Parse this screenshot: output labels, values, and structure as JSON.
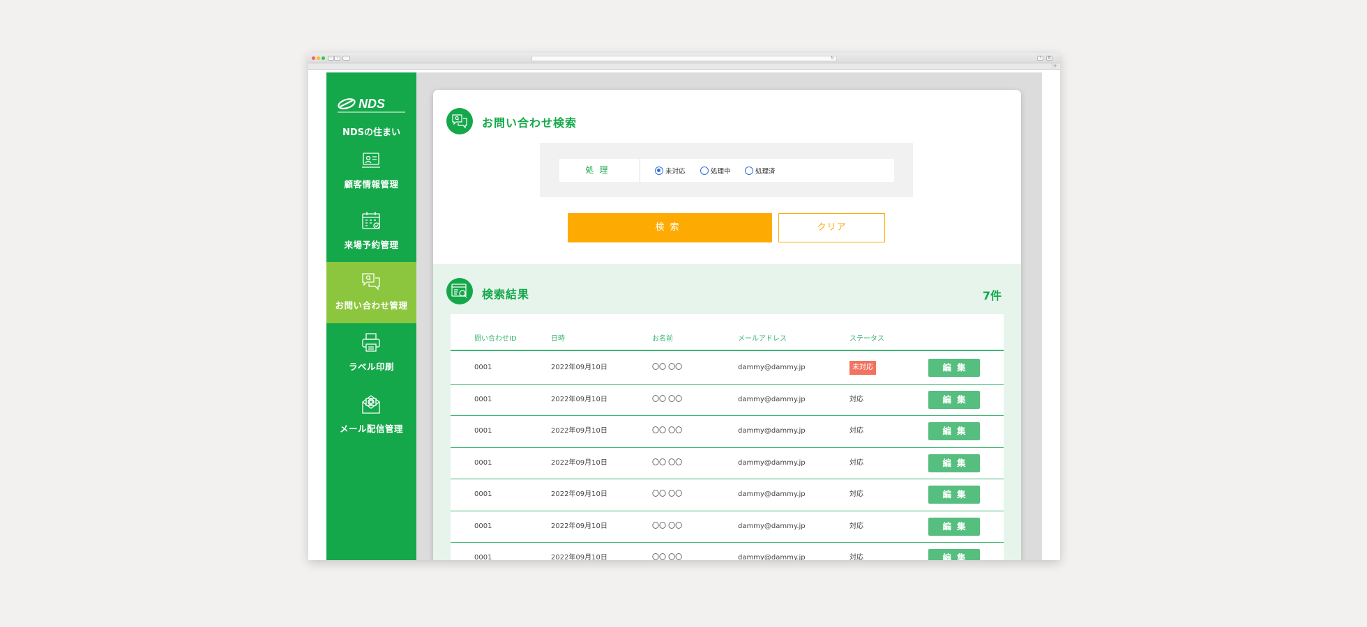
{
  "sidebar": {
    "brand": "NDSの住まい",
    "logo_text": "NDS",
    "items": [
      {
        "label": "顧客情報管理",
        "icon": "customer-info-icon"
      },
      {
        "label": "来場予約管理",
        "icon": "calendar-icon"
      },
      {
        "label": "お問い合わせ管理",
        "icon": "inquiry-icon",
        "active": true
      },
      {
        "label": "ラベル印刷",
        "icon": "printer-icon"
      },
      {
        "label": "メール配信管理",
        "icon": "mail-icon"
      }
    ]
  },
  "search": {
    "title": "お問い合わせ検索",
    "filter_label": "処理",
    "options": [
      {
        "label": "未対応",
        "checked": true
      },
      {
        "label": "処理中",
        "checked": false
      },
      {
        "label": "処理済",
        "checked": false
      }
    ],
    "search_button": "検索",
    "clear_button": "クリア"
  },
  "results": {
    "title": "検索結果",
    "count": "7件",
    "columns": [
      "問い合わせID",
      "日時",
      "お名前",
      "メールアドレス",
      "ステータス"
    ],
    "edit_label": "編集",
    "rows": [
      {
        "id": "0001",
        "date": "2022年09月10日",
        "name": "〇〇 〇〇",
        "email": "dammy@dammy.jp",
        "status": "未対応",
        "status_badge": true
      },
      {
        "id": "0001",
        "date": "2022年09月10日",
        "name": "〇〇 〇〇",
        "email": "dammy@dammy.jp",
        "status": "対応"
      },
      {
        "id": "0001",
        "date": "2022年09月10日",
        "name": "〇〇 〇〇",
        "email": "dammy@dammy.jp",
        "status": "対応"
      },
      {
        "id": "0001",
        "date": "2022年09月10日",
        "name": "〇〇 〇〇",
        "email": "dammy@dammy.jp",
        "status": "対応"
      },
      {
        "id": "0001",
        "date": "2022年09月10日",
        "name": "〇〇 〇〇",
        "email": "dammy@dammy.jp",
        "status": "対応"
      },
      {
        "id": "0001",
        "date": "2022年09月10日",
        "name": "〇〇 〇〇",
        "email": "dammy@dammy.jp",
        "status": "対応"
      },
      {
        "id": "0001",
        "date": "2022年09月10日",
        "name": "〇〇 〇〇",
        "email": "dammy@dammy.jp",
        "status": "対応"
      }
    ]
  },
  "colors": {
    "primary_green": "#15a84a",
    "active_green": "#8cc63e",
    "orange": "#fdab03",
    "badge_red": "#f2735f",
    "results_bg": "#e6f4ec"
  }
}
